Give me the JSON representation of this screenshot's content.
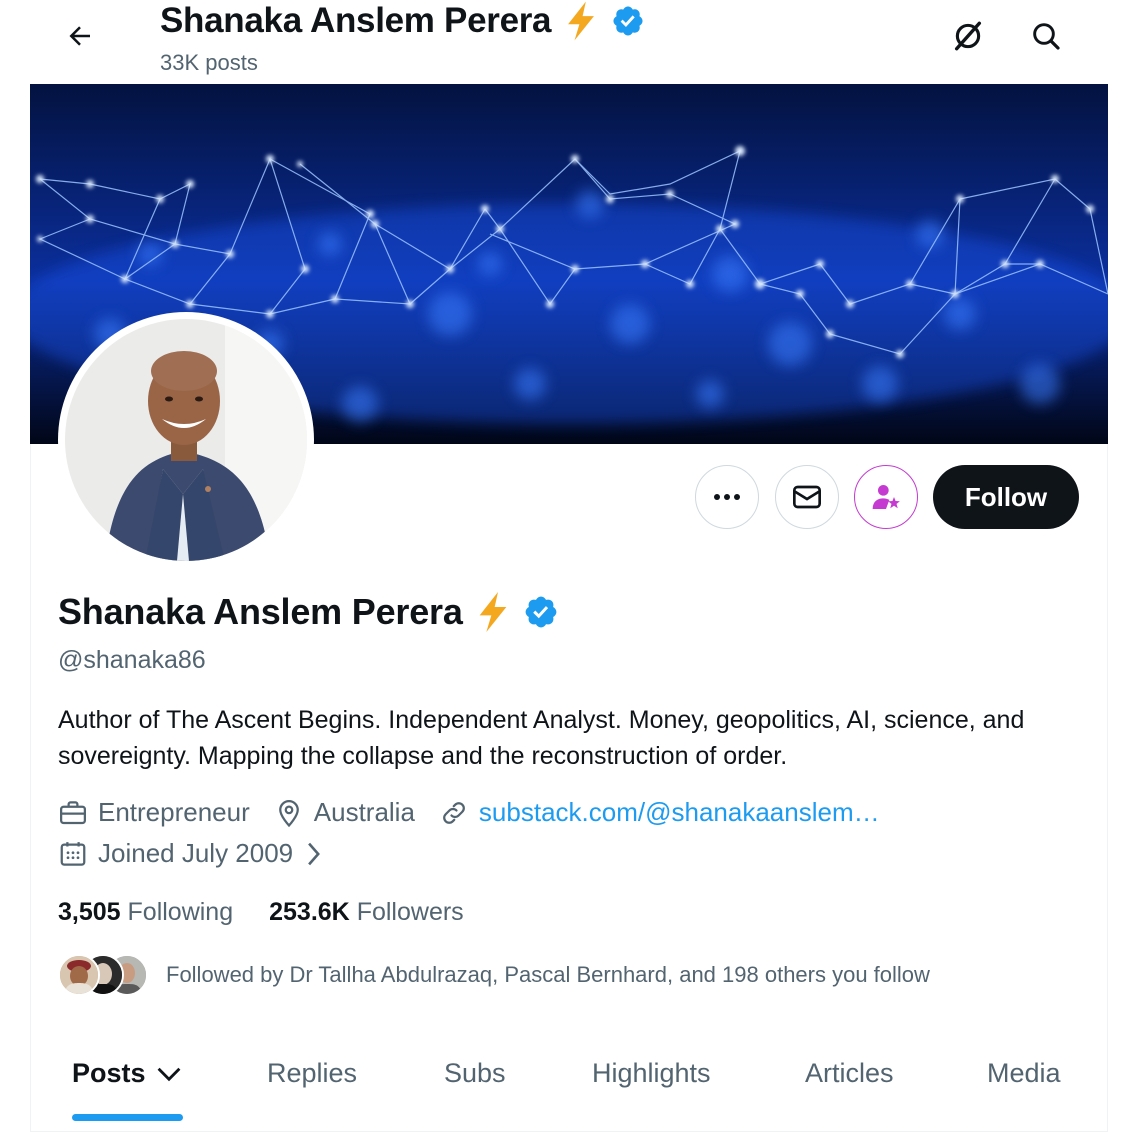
{
  "header": {
    "title": "Shanaka Anslem Perera",
    "posts_count": "33K posts"
  },
  "profile": {
    "name": "Shanaka Anslem Perera",
    "handle": "@shanaka86",
    "bio": "Author of The Ascent Begins. Independent Analyst. Money, geopolitics, AI, science, and sovereignty. Mapping the collapse and the reconstruction of order.",
    "profession": "Entrepreneur",
    "location": "Australia",
    "website": "substack.com/@shanakaanslem…",
    "joined": "Joined July 2009",
    "following_count": "3,505",
    "following_label": "Following",
    "followers_count": "253.6K",
    "followers_label": "Followers",
    "followed_by": "Followed by Dr Tallha Abdulrazaq, Pascal Bernhard, and 198 others you follow"
  },
  "actions": {
    "follow_label": "Follow"
  },
  "tabs": [
    {
      "label": "Posts",
      "active": true
    },
    {
      "label": "Replies",
      "active": false
    },
    {
      "label": "Subs",
      "active": false
    },
    {
      "label": "Highlights",
      "active": false
    },
    {
      "label": "Articles",
      "active": false
    },
    {
      "label": "Media",
      "active": false
    }
  ],
  "colors": {
    "accent": "#1d9bf0",
    "verified": "#1d9bf0",
    "lightning": "#f4a820",
    "subscribe": "#c53bd1",
    "text_primary": "#0f1419",
    "text_secondary": "#536471"
  }
}
